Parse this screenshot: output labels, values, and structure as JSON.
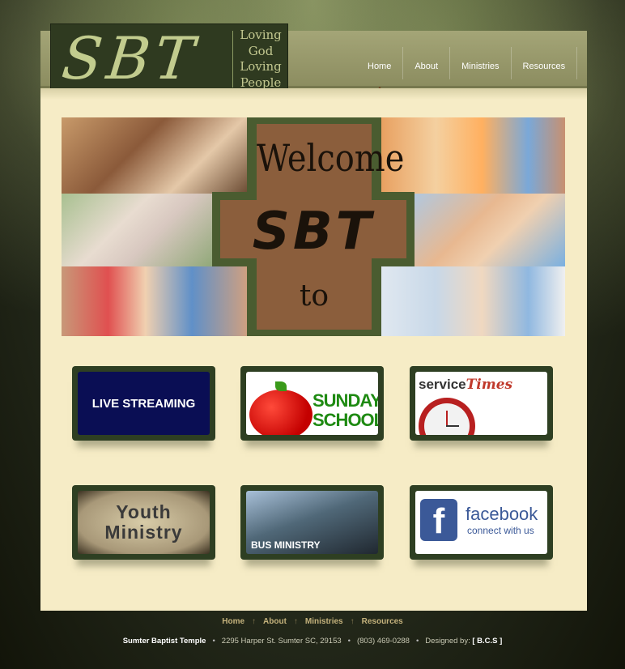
{
  "logo": {
    "text": "SBT",
    "tagline": [
      "Loving",
      "God",
      "Loving",
      "People"
    ]
  },
  "nav": {
    "items": [
      "Home",
      "About",
      "Ministries",
      "Resources"
    ],
    "active": "Home"
  },
  "banner": {
    "line1": "Welcome",
    "line2": "SBT",
    "line3": "to"
  },
  "tiles": [
    {
      "label": "LIVE STREAMING"
    },
    {
      "line1": "SUNDAY",
      "line2": "SCHOOL"
    },
    {
      "word1": "service",
      "word2": "Times"
    },
    {
      "line1": "Youth",
      "line2": "Ministry"
    },
    {
      "label": "BUS MINISTRY"
    },
    {
      "title": "facebook",
      "subtitle": "connect with us",
      "icon": "f"
    }
  ],
  "footer": {
    "links": [
      "Home",
      "About",
      "Ministries",
      "Resources"
    ],
    "name": "Sumter Baptist Temple",
    "address": "2295 Harper St. Sumter SC, 29153",
    "phone": "(803) 469-0288",
    "designed_label": "Designed by:",
    "designer": "[ B.C.S ]"
  },
  "colors": {
    "logo_bg": "#2f3a20",
    "logo_text": "#c2cc8e",
    "content_bg": "#f6ecc6",
    "cross_brown": "#8b5e3c",
    "tile_frame": "#2e3f22",
    "footer_link": "#c4b27c"
  }
}
